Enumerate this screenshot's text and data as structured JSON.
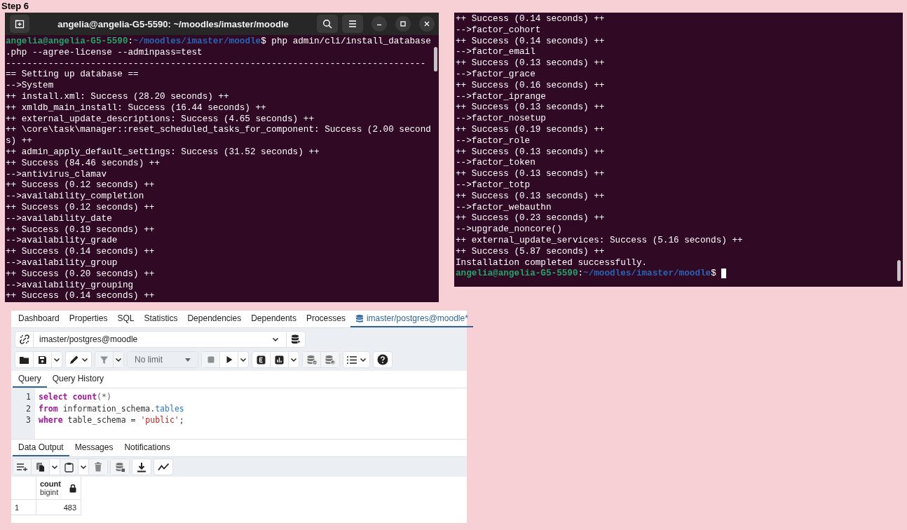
{
  "step_title": "Step 6",
  "terminal_left": {
    "title": "angelia@angelia-G5-5590: ~/moodles/imaster/moodle",
    "lines": [
      {
        "kind": "prompt",
        "user": "angelia@angelia-G5-5590",
        "sep": ":",
        "path": "~/moodles/imaster/moodle",
        "command": "$ php admin/cli/install_database",
        "cursor": false
      },
      {
        "kind": "text",
        "text": ".php --agree-license --adminpass=test"
      },
      {
        "kind": "text",
        "text": "-------------------------------------------------------------------------------"
      },
      {
        "kind": "text",
        "text": "== Setting up database =="
      },
      {
        "kind": "text",
        "text": "-->System"
      },
      {
        "kind": "text",
        "text": "++ install.xml: Success (28.20 seconds) ++"
      },
      {
        "kind": "text",
        "text": "++ xmldb_main_install: Success (16.44 seconds) ++"
      },
      {
        "kind": "text",
        "text": "++ external_update_descriptions: Success (4.65 seconds) ++"
      },
      {
        "kind": "text",
        "text": "++ \\core\\task\\manager::reset_scheduled_tasks_for_component: Success (2.00 second"
      },
      {
        "kind": "text",
        "text": "s) ++"
      },
      {
        "kind": "text",
        "text": "++ admin_apply_default_settings: Success (31.52 seconds) ++"
      },
      {
        "kind": "text",
        "text": "++ Success (84.46 seconds) ++"
      },
      {
        "kind": "text",
        "text": "-->antivirus_clamav"
      },
      {
        "kind": "text",
        "text": "++ Success (0.12 seconds) ++"
      },
      {
        "kind": "text",
        "text": "-->availability_completion"
      },
      {
        "kind": "text",
        "text": "++ Success (0.12 seconds) ++"
      },
      {
        "kind": "text",
        "text": "-->availability_date"
      },
      {
        "kind": "text",
        "text": "++ Success (0.19 seconds) ++"
      },
      {
        "kind": "text",
        "text": "-->availability_grade"
      },
      {
        "kind": "text",
        "text": "++ Success (0.14 seconds) ++"
      },
      {
        "kind": "text",
        "text": "-->availability_group"
      },
      {
        "kind": "text",
        "text": "++ Success (0.20 seconds) ++"
      },
      {
        "kind": "text",
        "text": "-->availability_grouping"
      },
      {
        "kind": "text",
        "text": "++ Success (0.14 seconds) ++"
      }
    ]
  },
  "terminal_right": {
    "lines": [
      {
        "kind": "text",
        "text": "++ Success (0.14 seconds) ++"
      },
      {
        "kind": "text",
        "text": "-->factor_cohort"
      },
      {
        "kind": "text",
        "text": "++ Success (0.14 seconds) ++"
      },
      {
        "kind": "text",
        "text": "-->factor_email"
      },
      {
        "kind": "text",
        "text": "++ Success (0.13 seconds) ++"
      },
      {
        "kind": "text",
        "text": "-->factor_grace"
      },
      {
        "kind": "text",
        "text": "++ Success (0.16 seconds) ++"
      },
      {
        "kind": "text",
        "text": "-->factor_iprange"
      },
      {
        "kind": "text",
        "text": "++ Success (0.13 seconds) ++"
      },
      {
        "kind": "text",
        "text": "-->factor_nosetup"
      },
      {
        "kind": "text",
        "text": "++ Success (0.19 seconds) ++"
      },
      {
        "kind": "text",
        "text": "-->factor_role"
      },
      {
        "kind": "text",
        "text": "++ Success (0.13 seconds) ++"
      },
      {
        "kind": "text",
        "text": "-->factor_token"
      },
      {
        "kind": "text",
        "text": "++ Success (0.13 seconds) ++"
      },
      {
        "kind": "text",
        "text": "-->factor_totp"
      },
      {
        "kind": "text",
        "text": "++ Success (0.13 seconds) ++"
      },
      {
        "kind": "text",
        "text": "-->factor_webauthn"
      },
      {
        "kind": "text",
        "text": "++ Success (0.23 seconds) ++"
      },
      {
        "kind": "text",
        "text": "-->upgrade_noncore()"
      },
      {
        "kind": "text",
        "text": "++ external_update_services: Success (5.16 seconds) ++"
      },
      {
        "kind": "text",
        "text": "++ Success (5.87 seconds) ++"
      },
      {
        "kind": "text",
        "text": "Installation completed successfully."
      },
      {
        "kind": "prompt",
        "user": "angelia@angelia-G5-5590",
        "sep": ":",
        "path": "~/moodles/imaster/moodle",
        "command": "$",
        "cursor": true
      }
    ]
  },
  "pgadmin": {
    "tabs": [
      {
        "label": "Dashboard",
        "kind": "plain",
        "selected": false
      },
      {
        "label": "Properties",
        "kind": "plain",
        "selected": false
      },
      {
        "label": "SQL",
        "kind": "plain",
        "selected": false
      },
      {
        "label": "Statistics",
        "kind": "plain",
        "selected": false
      },
      {
        "label": "Dependencies",
        "kind": "plain",
        "selected": false
      },
      {
        "label": "Dependents",
        "kind": "plain",
        "selected": false
      },
      {
        "label": "Processes",
        "kind": "plain",
        "selected": false
      },
      {
        "label": "imaster/postgres@moodle*",
        "kind": "query",
        "selected": true
      }
    ],
    "connection": "imaster/postgres@moodle",
    "limit": {
      "value": "No limit",
      "disabled": true
    },
    "editor_tabs": [
      {
        "label": "Query",
        "selected": true
      },
      {
        "label": "Query History",
        "selected": false
      }
    ],
    "code_lines": [
      {
        "number": "1",
        "tokens": [
          {
            "text": "select count",
            "kind": "keyword"
          },
          {
            "text": "(*)",
            "kind": "punct"
          }
        ]
      },
      {
        "number": "2",
        "tokens": [
          {
            "text": "from",
            "kind": "keyword"
          },
          {
            "text": " information_schema.",
            "kind": "plain"
          },
          {
            "text": "tables",
            "kind": "property"
          }
        ]
      },
      {
        "number": "3",
        "tokens": [
          {
            "text": "where",
            "kind": "keyword"
          },
          {
            "text": " table_schema = ",
            "kind": "plain"
          },
          {
            "text": "'public'",
            "kind": "string"
          },
          {
            "text": ";",
            "kind": "plain"
          }
        ]
      }
    ],
    "output_tabs": [
      {
        "label": "Data Output",
        "selected": true
      },
      {
        "label": "Messages",
        "selected": false
      },
      {
        "label": "Notifications",
        "selected": false
      }
    ],
    "grid": {
      "columns": [
        {
          "name": "count",
          "type": "bigint",
          "locked": true
        }
      ],
      "rows": [
        {
          "number": "1",
          "cells": [
            "483"
          ]
        }
      ]
    }
  }
}
